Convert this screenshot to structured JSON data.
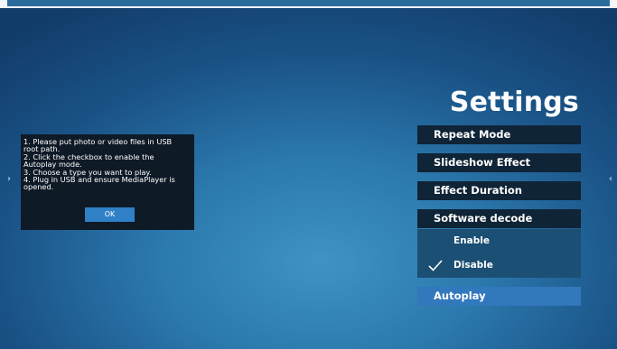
{
  "title": "Settings",
  "info_dialog": {
    "lines": [
      "1. Please put photo or video files in USB",
      "root path.",
      "2. Click the checkbox to enable the",
      "Autoplay mode.",
      "3. Choose a type you want to play.",
      "4. Plug in USB and ensure MediaPlayer is",
      "opened."
    ],
    "ok_label": "OK"
  },
  "menu": {
    "items": [
      {
        "label": "Repeat Mode"
      },
      {
        "label": "Slideshow Effect"
      },
      {
        "label": "Effect Duration"
      },
      {
        "label": "Software decode"
      },
      {
        "label": "Autoplay"
      }
    ],
    "software_decode_options": [
      {
        "label": "Enable",
        "checked": false
      },
      {
        "label": "Disable",
        "checked": true
      }
    ]
  },
  "icons": {
    "left_nav": "chevron-right-icon",
    "right_nav": "chevron-left-icon",
    "check": "checkmark-icon"
  },
  "colors": {
    "menu_item_bg": "#0f2436",
    "menu_item_active_bg": "#3278bd",
    "ok_button_bg": "#2f80c6"
  }
}
